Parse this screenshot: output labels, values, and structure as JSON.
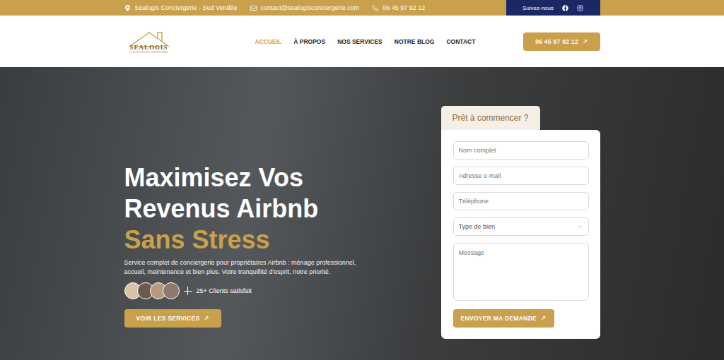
{
  "topbar": {
    "location": "Sealogis Conciergerie - Sud Vendée",
    "email": "contact@sealogisconciergerie.com",
    "phone": "06 45 97 92 12",
    "social_label": "Suivez-nous"
  },
  "logo": {
    "name": "SEALOGIS",
    "tagline": "CONCIERGERIE & PATRIMOINES"
  },
  "nav": {
    "items": [
      {
        "label": "ACCUEIL",
        "selected": true
      },
      {
        "label": "À PROPOS",
        "selected": false
      },
      {
        "label": "NOS SERVICES",
        "selected": false
      },
      {
        "label": "NOTRE BLOG",
        "selected": false
      },
      {
        "label": "CONTACT",
        "selected": false
      }
    ],
    "call_button": {
      "label": "06 45 97 92 12",
      "arrow": "↗"
    }
  },
  "hero": {
    "title_lines": [
      "Maximisez Vos",
      "Revenus Airbnb"
    ],
    "highlight": "Sans Stress",
    "description": "Service complet de conciergerie pour propriétaires Airbnb : ménage professionnel, accueil, maintenance et bien plus. Votre tranquillité d'esprit, notre priorité.",
    "clients": "25+ Clients satisfait",
    "cta": {
      "label": "VOIR LES SERVICES",
      "arrow": "↗"
    }
  },
  "form": {
    "tab": "Prêt à commencer ?",
    "fields": [
      {
        "kind": "input",
        "placeholder": "Nom complet"
      },
      {
        "kind": "input",
        "placeholder": "Adresse e-mail"
      },
      {
        "kind": "input",
        "placeholder": "Téléphone"
      },
      {
        "kind": "select",
        "placeholder": "Type de bien"
      },
      {
        "kind": "textarea",
        "placeholder": "Message"
      }
    ],
    "submit": {
      "label": "ENVOYER MA DEMANDE",
      "arrow": "↗"
    }
  }
}
